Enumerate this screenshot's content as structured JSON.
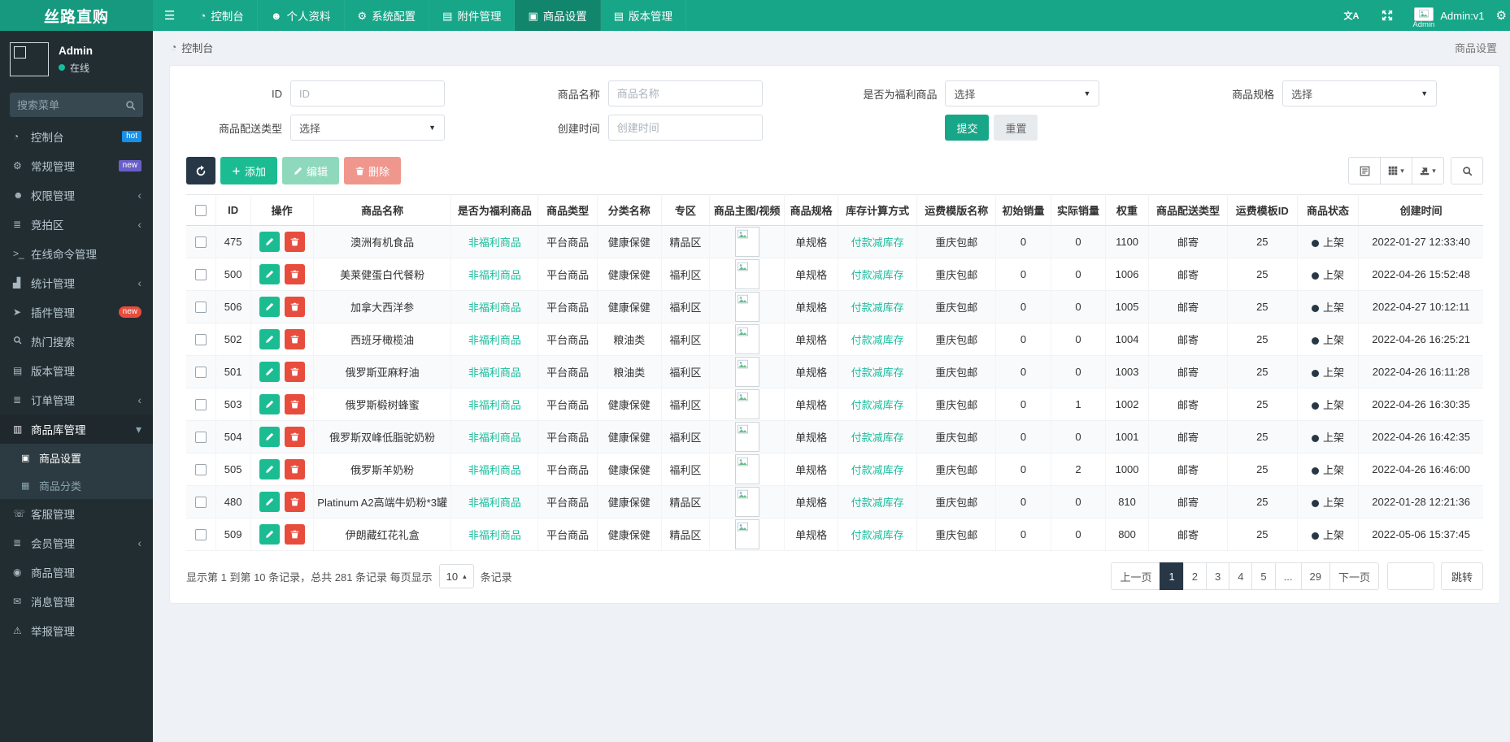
{
  "colors": {
    "accent": "#18a689",
    "nav_active": "#11866d",
    "sidebar_bg": "#222d32",
    "green_text": "#1abc9c",
    "red": "#e74c3c",
    "dark_btn": "#273746",
    "online_dot": "#18bc9c",
    "badge_hot": "#1890e8",
    "badge_new_purple": "#6a5fc7",
    "badge_new_red": "#e74c3c"
  },
  "icons": {
    "hamburger": "☰",
    "dashboard": "◔",
    "user": "☻",
    "gear": "⚙",
    "file": "▤",
    "gift": "▣",
    "users": "☻",
    "list": "≣",
    "terminal": ">_",
    "chart": "▟",
    "plane": "➤",
    "basket": "▥",
    "grid": "▦",
    "phone": "☏",
    "bell": "◉",
    "comment": "✉",
    "warning": "⚠",
    "orders": "≣",
    "caret_down": "▾",
    "caret_up": "▴",
    "chevron_left": "‹",
    "chevron_down": "▾",
    "dot": "●"
  },
  "navbar": {
    "brand": "丝路直购",
    "items": [
      {
        "label": "控制台",
        "icon": "dashboard",
        "active": false
      },
      {
        "label": "个人资料",
        "icon": "user",
        "active": false
      },
      {
        "label": "系统配置",
        "icon": "gear",
        "active": false
      },
      {
        "label": "附件管理",
        "icon": "file",
        "active": false
      },
      {
        "label": "商品设置",
        "icon": "gift",
        "active": true
      },
      {
        "label": "版本管理",
        "icon": "file",
        "active": false
      }
    ],
    "translate_label": "文A",
    "user_title": "Admin:v1",
    "user_alt": "Admin"
  },
  "sidebar": {
    "user_name": "Admin",
    "user_status": "在线",
    "search_placeholder": "搜索菜单",
    "items": [
      {
        "label": "控制台",
        "icon": "dashboard",
        "badge": "hot",
        "badge_style": "blue"
      },
      {
        "label": "常规管理",
        "icon": "gear",
        "badge": "new",
        "badge_style": "purple"
      },
      {
        "label": "权限管理",
        "icon": "users",
        "chevron": "left"
      },
      {
        "label": "竞拍区",
        "icon": "list",
        "chevron": "left"
      },
      {
        "label": "在线命令管理",
        "icon": "terminal"
      },
      {
        "label": "统计管理",
        "icon": "chart",
        "chevron": "left"
      },
      {
        "label": "插件管理",
        "icon": "plane",
        "badge": "new",
        "badge_style": "red"
      },
      {
        "label": "热门搜索",
        "icon": "search"
      },
      {
        "label": "版本管理",
        "icon": "file"
      },
      {
        "label": "订单管理",
        "icon": "orders",
        "chevron": "left"
      },
      {
        "label": "商品库管理",
        "icon": "basket",
        "chevron": "down",
        "active": true,
        "children": [
          {
            "label": "商品设置",
            "icon": "gift",
            "active": true
          },
          {
            "label": "商品分类",
            "icon": "grid",
            "active": false
          }
        ]
      },
      {
        "label": "客服管理",
        "icon": "phone"
      },
      {
        "label": "会员管理",
        "icon": "list",
        "chevron": "left"
      },
      {
        "label": "商品管理",
        "icon": "bell"
      },
      {
        "label": "消息管理",
        "icon": "comment"
      },
      {
        "label": "举报管理",
        "icon": "warning"
      }
    ]
  },
  "breadcrumb": {
    "left": "控制台",
    "right": "商品设置"
  },
  "filters": {
    "fields": [
      {
        "label": "ID",
        "type": "input",
        "placeholder": "ID"
      },
      {
        "label": "商品名称",
        "type": "input",
        "placeholder": "商品名称"
      },
      {
        "label": "是否为福利商品",
        "type": "select",
        "value": "选择"
      },
      {
        "label": "商品规格",
        "type": "select",
        "value": "选择"
      },
      {
        "label": "商品配送类型",
        "type": "select",
        "value": "选择"
      },
      {
        "label": "创建时间",
        "type": "input",
        "placeholder": "创建时间"
      }
    ],
    "submit_label": "提交",
    "reset_label": "重置"
  },
  "toolbar": {
    "add_label": "添加",
    "edit_label": "编辑",
    "delete_label": "删除"
  },
  "table": {
    "columns": [
      "",
      "ID",
      "操作",
      "商品名称",
      "是否为福利商品",
      "商品类型",
      "分类名称",
      "专区",
      "商品主图/视频",
      "商品规格",
      "库存计算方式",
      "运费模版名称",
      "初始销量",
      "实际销量",
      "权重",
      "商品配送类型",
      "运费模板ID",
      "商品状态",
      "创建时间"
    ],
    "rows": [
      {
        "id": "475",
        "name": "澳洲有机食品",
        "welfare": "非福利商品",
        "type": "平台商品",
        "category": "健康保健",
        "zone": "精品区",
        "spec": "单规格",
        "stock_calc": "付款减库存",
        "freight_tpl": "重庆包邮",
        "init_sales": "0",
        "real_sales": "0",
        "weight": "1100",
        "delivery": "邮寄",
        "freight_id": "25",
        "status": "上架",
        "created": "2022-01-27 12:33:40"
      },
      {
        "id": "500",
        "name": "美莱健蛋白代餐粉",
        "welfare": "非福利商品",
        "type": "平台商品",
        "category": "健康保健",
        "zone": "福利区",
        "spec": "单规格",
        "stock_calc": "付款减库存",
        "freight_tpl": "重庆包邮",
        "init_sales": "0",
        "real_sales": "0",
        "weight": "1006",
        "delivery": "邮寄",
        "freight_id": "25",
        "status": "上架",
        "created": "2022-04-26 15:52:48"
      },
      {
        "id": "506",
        "name": "加拿大西洋参",
        "welfare": "非福利商品",
        "type": "平台商品",
        "category": "健康保健",
        "zone": "福利区",
        "spec": "单规格",
        "stock_calc": "付款减库存",
        "freight_tpl": "重庆包邮",
        "init_sales": "0",
        "real_sales": "0",
        "weight": "1005",
        "delivery": "邮寄",
        "freight_id": "25",
        "status": "上架",
        "created": "2022-04-27 10:12:11"
      },
      {
        "id": "502",
        "name": "西班牙橄榄油",
        "welfare": "非福利商品",
        "type": "平台商品",
        "category": "粮油类",
        "zone": "福利区",
        "spec": "单规格",
        "stock_calc": "付款减库存",
        "freight_tpl": "重庆包邮",
        "init_sales": "0",
        "real_sales": "0",
        "weight": "1004",
        "delivery": "邮寄",
        "freight_id": "25",
        "status": "上架",
        "created": "2022-04-26 16:25:21"
      },
      {
        "id": "501",
        "name": "俄罗斯亚麻籽油",
        "welfare": "非福利商品",
        "type": "平台商品",
        "category": "粮油类",
        "zone": "福利区",
        "spec": "单规格",
        "stock_calc": "付款减库存",
        "freight_tpl": "重庆包邮",
        "init_sales": "0",
        "real_sales": "0",
        "weight": "1003",
        "delivery": "邮寄",
        "freight_id": "25",
        "status": "上架",
        "created": "2022-04-26 16:11:28"
      },
      {
        "id": "503",
        "name": "俄罗斯椴树蜂蜜",
        "welfare": "非福利商品",
        "type": "平台商品",
        "category": "健康保健",
        "zone": "福利区",
        "spec": "单规格",
        "stock_calc": "付款减库存",
        "freight_tpl": "重庆包邮",
        "init_sales": "0",
        "real_sales": "1",
        "weight": "1002",
        "delivery": "邮寄",
        "freight_id": "25",
        "status": "上架",
        "created": "2022-04-26 16:30:35"
      },
      {
        "id": "504",
        "name": "俄罗斯双峰低脂驼奶粉",
        "welfare": "非福利商品",
        "type": "平台商品",
        "category": "健康保健",
        "zone": "福利区",
        "spec": "单规格",
        "stock_calc": "付款减库存",
        "freight_tpl": "重庆包邮",
        "init_sales": "0",
        "real_sales": "0",
        "weight": "1001",
        "delivery": "邮寄",
        "freight_id": "25",
        "status": "上架",
        "created": "2022-04-26 16:42:35"
      },
      {
        "id": "505",
        "name": "俄罗斯羊奶粉",
        "welfare": "非福利商品",
        "type": "平台商品",
        "category": "健康保健",
        "zone": "福利区",
        "spec": "单规格",
        "stock_calc": "付款减库存",
        "freight_tpl": "重庆包邮",
        "init_sales": "0",
        "real_sales": "2",
        "weight": "1000",
        "delivery": "邮寄",
        "freight_id": "25",
        "status": "上架",
        "created": "2022-04-26 16:46:00"
      },
      {
        "id": "480",
        "name": "Platinum A2高端牛奶粉*3罐",
        "welfare": "非福利商品",
        "type": "平台商品",
        "category": "健康保健",
        "zone": "精品区",
        "spec": "单规格",
        "stock_calc": "付款减库存",
        "freight_tpl": "重庆包邮",
        "init_sales": "0",
        "real_sales": "0",
        "weight": "810",
        "delivery": "邮寄",
        "freight_id": "25",
        "status": "上架",
        "created": "2022-01-28 12:21:36"
      },
      {
        "id": "509",
        "name": "伊朗藏红花礼盒",
        "welfare": "非福利商品",
        "type": "平台商品",
        "category": "健康保健",
        "zone": "精品区",
        "spec": "单规格",
        "stock_calc": "付款减库存",
        "freight_tpl": "重庆包邮",
        "init_sales": "0",
        "real_sales": "0",
        "weight": "800",
        "delivery": "邮寄",
        "freight_id": "25",
        "status": "上架",
        "created": "2022-05-06 15:37:45"
      }
    ]
  },
  "pagination": {
    "info_before": "显示第 1 到第 10 条记录，总共 281 条记录 每页显示",
    "per_page": "10",
    "info_after": "条记录",
    "prev_label": "上一页",
    "next_label": "下一页",
    "pages": [
      "1",
      "2",
      "3",
      "4",
      "5",
      "...",
      "29"
    ],
    "active_page": "1",
    "jump_label": "跳转"
  }
}
